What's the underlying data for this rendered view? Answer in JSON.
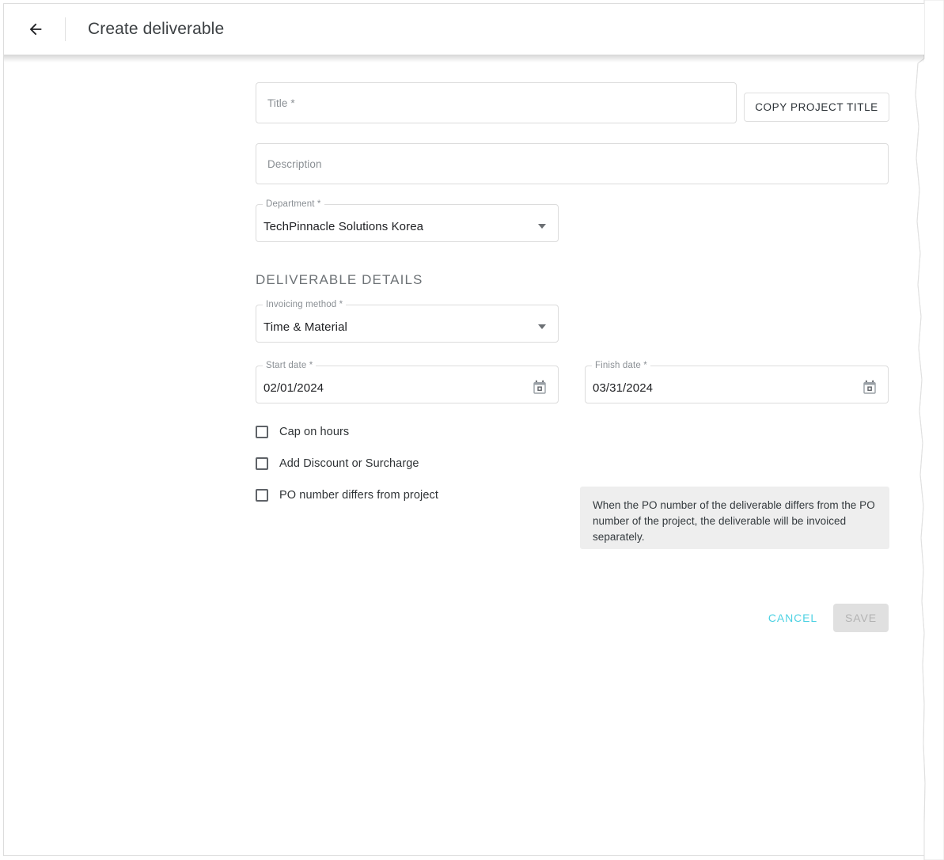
{
  "appbar": {
    "back_icon": "arrow-left-icon",
    "title": "Create deliverable"
  },
  "form": {
    "title_field": {
      "placeholder": "Title *",
      "value": ""
    },
    "copy_project_title_button": "COPY PROJECT TITLE",
    "description_field": {
      "placeholder": "Description",
      "value": ""
    },
    "department_field": {
      "label": "Department *",
      "value": "TechPinnacle Solutions Korea",
      "caret_icon": "chevron-down-icon"
    },
    "section_heading": "DELIVERABLE DETAILS",
    "invoicing_method_field": {
      "label": "Invoicing method *",
      "value": "Time & Material",
      "caret_icon": "chevron-down-icon"
    },
    "start_date_field": {
      "label": "Start date *",
      "value": "02/01/2024",
      "icon": "calendar-icon"
    },
    "finish_date_field": {
      "label": "Finish date *",
      "value": "03/31/2024",
      "icon": "calendar-icon"
    },
    "checkboxes": [
      {
        "label": "Cap on hours",
        "checked": false
      },
      {
        "label": "Add Discount or Surcharge",
        "checked": false
      },
      {
        "label": "PO number differs from project",
        "checked": false
      }
    ],
    "info_panel": {
      "text": "When the PO number of the deliverable differs from the PO number of the project, the deliverable will be invoiced separately."
    }
  },
  "actions": {
    "cancel_label": "CANCEL",
    "save_label": "SAVE",
    "save_disabled": true
  },
  "colors": {
    "accent": "#4fd2e3",
    "disabled_bg": "#e0e0e0",
    "disabled_text": "#b3b3b3",
    "info_bg": "#eeeeee",
    "border": "#dcdcdc",
    "text": "#2f3336",
    "muted_text": "#8a8f94"
  }
}
